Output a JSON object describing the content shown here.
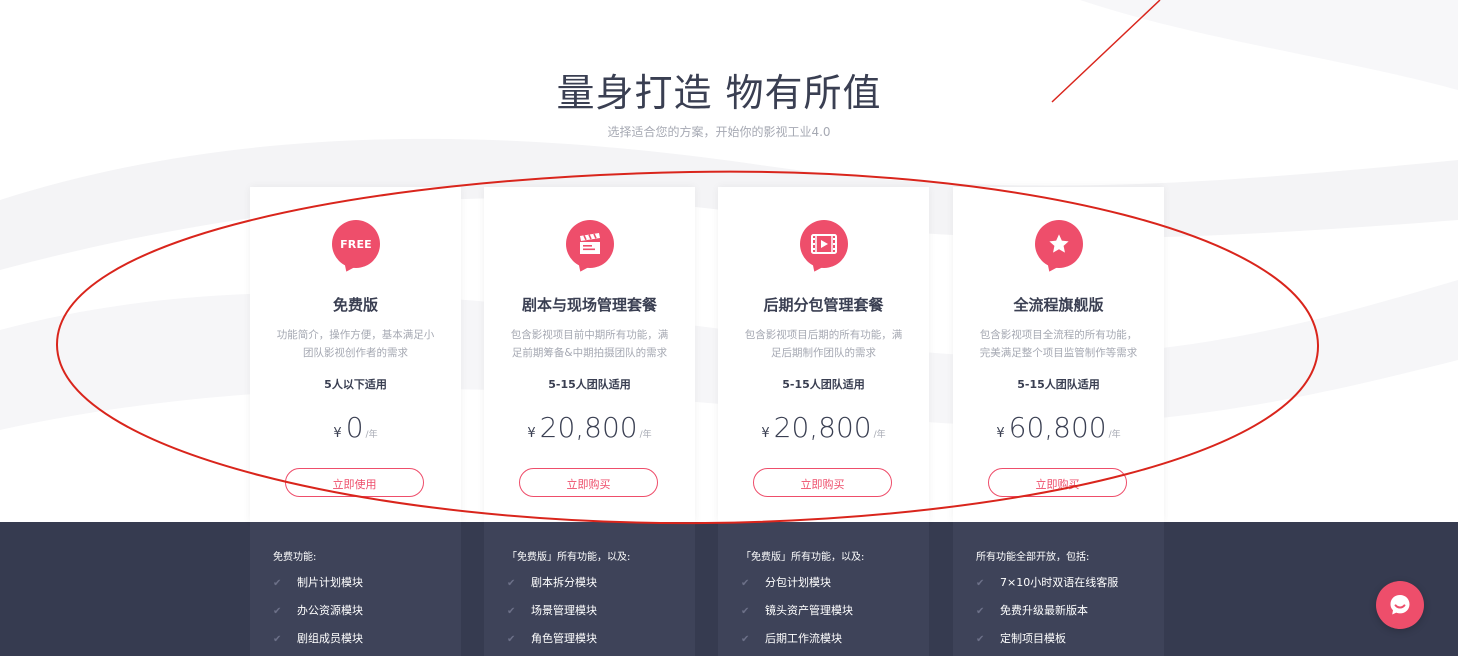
{
  "hero": {
    "title": "量身打造 物有所值",
    "subtitle": "选择适合您的方案，开始你的影视工业4.0"
  },
  "colors": {
    "accent": "#ee4e6b",
    "dark_band": "#363b50",
    "feature_col_bg": "#3e4359",
    "annotation_red": "#d9251c"
  },
  "currency_symbol": "¥",
  "price_unit": "/年",
  "plans": [
    {
      "icon": "free-badge-icon",
      "icon_text": "FREE",
      "name": "免费版",
      "desc_line1": "功能简介，操作方便，基本满足小",
      "desc_line2": "团队影视创作者的需求",
      "team": "5人以下适用",
      "price": "0",
      "button_label": "立即使用",
      "features_intro": "免费功能:",
      "features": [
        "制片计划模块",
        "办公资源模块",
        "剧组成员模块"
      ]
    },
    {
      "icon": "clapperboard-icon",
      "name": "剧本与现场管理套餐",
      "desc_line1": "包含影视项目前中期所有功能，满",
      "desc_line2": "足前期筹备&中期拍摄团队的需求",
      "team": "5-15人团队适用",
      "price": "20,800",
      "button_label": "立即购买",
      "features_intro": "「免费版」所有功能，以及:",
      "features": [
        "剧本拆分模块",
        "场景管理模块",
        "角色管理模块"
      ]
    },
    {
      "icon": "film-play-icon",
      "name": "后期分包管理套餐",
      "desc_line1": "包含影视项目后期的所有功能，满",
      "desc_line2": "足后期制作团队的需求",
      "team": "5-15人团队适用",
      "price": "20,800",
      "button_label": "立即购买",
      "features_intro": "「免费版」所有功能，以及:",
      "features": [
        "分包计划模块",
        "镜头资产管理模块",
        "后期工作流模块"
      ]
    },
    {
      "icon": "star-icon",
      "name": "全流程旗舰版",
      "desc_line1": "包含影视项目全流程的所有功能，",
      "desc_line2": "完美满足整个项目监管制作等需求",
      "team": "5-15人团队适用",
      "price": "60,800",
      "button_label": "立即购买",
      "features_intro": "所有功能全部开放，包括:",
      "features": [
        "7×10小时双语在线客服",
        "免费升级最新版本",
        "定制项目模板"
      ]
    }
  ],
  "chat": {
    "icon": "chat-smile-icon"
  }
}
